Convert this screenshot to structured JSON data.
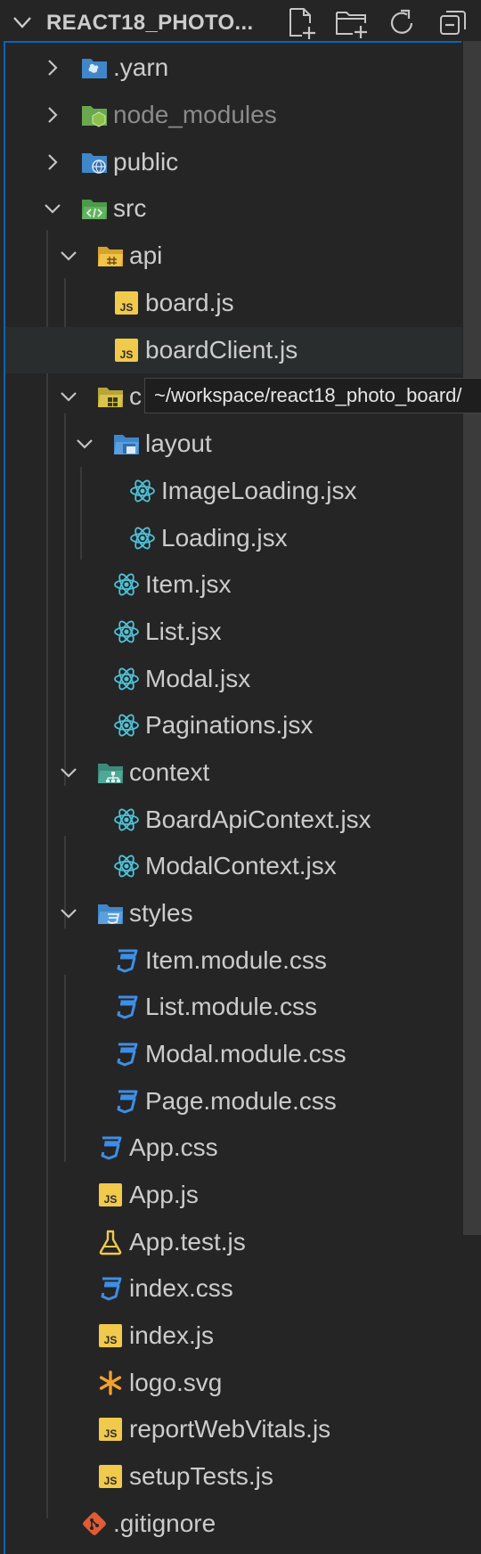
{
  "explorer": {
    "title": "REACT18_PHOTO...",
    "actions": [
      "new-file-icon",
      "new-folder-icon",
      "refresh-icon",
      "collapse-all-icon"
    ]
  },
  "tooltip": {
    "text": "~/workspace/react18_photo_board/"
  },
  "colors": {
    "background": "#252526",
    "focus_border": "#0b63b8",
    "js_yellow": "#f1c94b",
    "react_cyan": "#4fc3d9",
    "css_blue": "#3e8ee6",
    "git_orange": "#e35b35"
  },
  "tree": {
    "items": [
      {
        "label": ".yarn",
        "kind": "folder",
        "expanded": false,
        "icon": "yarn-folder-icon"
      },
      {
        "label": "node_modules",
        "kind": "folder",
        "expanded": false,
        "icon": "node-folder-icon"
      },
      {
        "label": "public",
        "kind": "folder",
        "expanded": false,
        "icon": "public-folder-icon"
      },
      {
        "label": "src",
        "kind": "folder",
        "expanded": true,
        "icon": "src-folder-icon"
      },
      {
        "label": "api",
        "kind": "folder",
        "expanded": true,
        "icon": "api-folder-icon"
      },
      {
        "label": "board.js",
        "kind": "file",
        "icon": "js-icon"
      },
      {
        "label": "boardClient.js",
        "kind": "file",
        "icon": "js-icon"
      },
      {
        "label": "c",
        "kind": "folder",
        "expanded": true,
        "icon": "components-folder-icon"
      },
      {
        "label": "layout",
        "kind": "folder",
        "expanded": true,
        "icon": "layout-folder-icon"
      },
      {
        "label": "ImageLoading.jsx",
        "kind": "file",
        "icon": "react-icon"
      },
      {
        "label": "Loading.jsx",
        "kind": "file",
        "icon": "react-icon"
      },
      {
        "label": "Item.jsx",
        "kind": "file",
        "icon": "react-icon"
      },
      {
        "label": "List.jsx",
        "kind": "file",
        "icon": "react-icon"
      },
      {
        "label": "Modal.jsx",
        "kind": "file",
        "icon": "react-icon"
      },
      {
        "label": "Paginations.jsx",
        "kind": "file",
        "icon": "react-icon"
      },
      {
        "label": "context",
        "kind": "folder",
        "expanded": true,
        "icon": "context-folder-icon"
      },
      {
        "label": "BoardApiContext.jsx",
        "kind": "file",
        "icon": "react-icon"
      },
      {
        "label": "ModalContext.jsx",
        "kind": "file",
        "icon": "react-icon"
      },
      {
        "label": "styles",
        "kind": "folder",
        "expanded": true,
        "icon": "styles-folder-icon"
      },
      {
        "label": "Item.module.css",
        "kind": "file",
        "icon": "css-icon"
      },
      {
        "label": "List.module.css",
        "kind": "file",
        "icon": "css-icon"
      },
      {
        "label": "Modal.module.css",
        "kind": "file",
        "icon": "css-icon"
      },
      {
        "label": "Page.module.css",
        "kind": "file",
        "icon": "css-icon"
      },
      {
        "label": "App.css",
        "kind": "file",
        "icon": "css-icon"
      },
      {
        "label": "App.js",
        "kind": "file",
        "icon": "js-icon"
      },
      {
        "label": "App.test.js",
        "kind": "file",
        "icon": "test-flask-icon"
      },
      {
        "label": "index.css",
        "kind": "file",
        "icon": "css-icon"
      },
      {
        "label": "index.js",
        "kind": "file",
        "icon": "js-icon"
      },
      {
        "label": "logo.svg",
        "kind": "file",
        "icon": "svg-asterisk-icon"
      },
      {
        "label": "reportWebVitals.js",
        "kind": "file",
        "icon": "js-icon"
      },
      {
        "label": "setupTests.js",
        "kind": "file",
        "icon": "js-icon"
      },
      {
        "label": ".gitignore",
        "kind": "file",
        "icon": "git-icon"
      }
    ]
  }
}
